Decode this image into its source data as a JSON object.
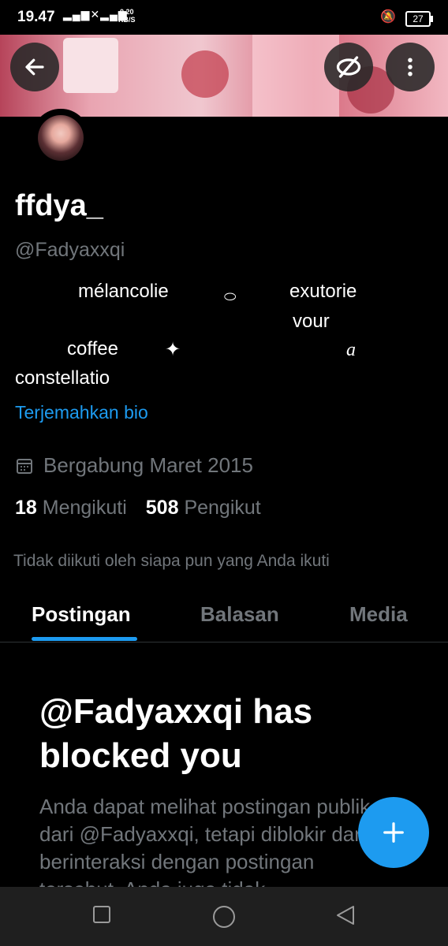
{
  "status_bar": {
    "time": "19.47",
    "net_speed_value": "0.20",
    "net_speed_unit": "KB/S",
    "battery": "27"
  },
  "profile": {
    "name": "ffdya_",
    "handle": "@Fadyaxxqi",
    "bio_lines": [
      "mélancolie",
      "exutorie",
      "vour",
      "coffee",
      "a",
      "constellatio"
    ],
    "translate_bio": "Terjemahkan bio",
    "joined": "Bergabung Maret 2015",
    "following_count": "18",
    "following_label": "Mengikuti",
    "followers_count": "508",
    "followers_label": "Pengikut",
    "not_followed_text": "Tidak diikuti oleh siapa pun yang Anda ikuti"
  },
  "tabs": [
    {
      "label": "Postingan"
    },
    {
      "label": "Balasan"
    },
    {
      "label": "Media"
    }
  ],
  "blocked": {
    "title": "@Fadyaxxqi has blocked you",
    "text": "Anda dapat melihat postingan publik dari @Fadyaxxqi, tetapi diblokir dari berinteraksi dengan postingan tersebut. Anda juga tidak"
  },
  "icons": {
    "back": "arrow-left-icon",
    "watch": "eye-off-icon",
    "more": "more-vertical-icon",
    "calendar": "calendar-icon",
    "compose": "plus-icon"
  },
  "colors": {
    "accent": "#1d9bf0",
    "muted": "#71767b",
    "background": "#000000"
  }
}
